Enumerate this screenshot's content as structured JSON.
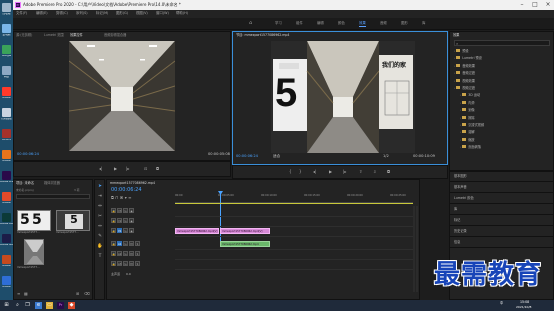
{
  "window": {
    "title": "Adobe Premiere Pro 2020 - C:\\用户\\Video\\文档\\Adobe\\Premiere Pro\\14.0\\未命名 *",
    "app_badge": "Pr"
  },
  "desktop": {
    "icons": [
      {
        "label": "回收站",
        "color": "#9fb7cc"
      },
      {
        "label": "此电脑",
        "color": "#7ab6e8"
      },
      {
        "label": "Google",
        "color": "#3aa35a"
      },
      {
        "label": "网络",
        "color": "#8da9c4"
      },
      {
        "label": "Adobe",
        "color": "#ff3a2a"
      },
      {
        "label": "控制面板",
        "color": "#c9d4e0"
      },
      {
        "label": "ACCES",
        "color": "#a5312b"
      },
      {
        "label": "Adobe",
        "color": "#e6741c"
      },
      {
        "label": "Adobe Premi",
        "color": "#2a0a4a"
      },
      {
        "label": "Adobe",
        "color": "#e34a2a"
      },
      {
        "label": "Adobe Audition",
        "color": "#0b3a38"
      },
      {
        "label": "Adobe Media",
        "color": "#1c1c48"
      },
      {
        "label": "Adobe",
        "color": "#c54a1e"
      },
      {
        "label": "Adobe",
        "color": "#2e6ed6"
      }
    ]
  },
  "menubar": {
    "items": [
      "文件(F)",
      "编辑(E)",
      "剪辑(C)",
      "序列(S)",
      "标记(M)",
      "图形(G)",
      "视图(V)",
      "窗口(W)",
      "帮助(H)"
    ]
  },
  "workspaces": {
    "items": [
      "学习",
      "组件",
      "编辑",
      "颜色",
      "效果",
      "音频",
      "图形",
      "库"
    ],
    "active_index": 4
  },
  "source_monitor": {
    "tabs": [
      "源:(无剪辑)",
      "Lumetri 范围",
      "效果控件",
      "音频剪辑混合器"
    ],
    "clip_tab": "mmexport1577086962.mp4",
    "timecode_in": "00:00:06:24",
    "timecode_out": "00:00:05:08",
    "fit": "适合"
  },
  "program_monitor": {
    "tab": "节目: mmexport1577086962.mp4",
    "timecode_in": "00:00:06:24",
    "timecode_out": "00:00:10:09",
    "fit": "适合",
    "resolution": "1/2",
    "sign_number": "5",
    "sign_text": "我们的家"
  },
  "project": {
    "tabs": [
      "项目: 未命名",
      "媒体浏览器"
    ],
    "file": "未命名.prproj",
    "item_count": "3 项",
    "search_placeholder": "",
    "items": [
      {
        "name": "mmexport1577...",
        "duration": "5:08"
      },
      {
        "name": "mmexport1577...",
        "duration": "5:08"
      },
      {
        "name": "mmexport1577...",
        "duration": "10:09"
      }
    ]
  },
  "timeline": {
    "tab": "mmexport1577086962.mp4",
    "timecode": "00:00:06:24",
    "ruler": [
      "00:00",
      "00:00:05:00",
      "00:00:10:00",
      "00:00:15:00",
      "00:00:20:00",
      "00:00:25:00"
    ],
    "tracks": [
      {
        "name": "V3"
      },
      {
        "name": "V2"
      },
      {
        "name": "V1"
      },
      {
        "name": "A1"
      },
      {
        "name": "A2"
      },
      {
        "name": "A3"
      }
    ],
    "master": "主声道",
    "master_value": "0.0",
    "clips": [
      {
        "label": "mmexport1577086962.mp4[V]",
        "track": "V1"
      },
      {
        "label": "mmexport1577086962.mp4[V]",
        "track": "V1"
      },
      {
        "label": "mmexport1577086962.mp4",
        "track": "A1"
      }
    ]
  },
  "effects": {
    "title": "效果",
    "search_placeholder": "",
    "tree": [
      {
        "label": "预设",
        "indent": 0
      },
      {
        "label": "Lumetri 预设",
        "indent": 0
      },
      {
        "label": "音频效果",
        "indent": 0
      },
      {
        "label": "音频过渡",
        "indent": 0
      },
      {
        "label": "视频效果",
        "indent": 0
      },
      {
        "label": "视频过渡",
        "indent": 0
      },
      {
        "label": "3D 运动",
        "indent": 1
      },
      {
        "label": "内滑",
        "indent": 1
      },
      {
        "label": "划像",
        "indent": 1
      },
      {
        "label": "擦除",
        "indent": 1
      },
      {
        "label": "沉浸式视频",
        "indent": 1
      },
      {
        "label": "溶解",
        "indent": 1
      },
      {
        "label": "缩放",
        "indent": 1
      },
      {
        "label": "页面剥落",
        "indent": 1
      }
    ],
    "sections": [
      "基本图形",
      "基本声音",
      "Lumetri 颜色",
      "库",
      "标记",
      "历史记录",
      "信息"
    ]
  },
  "taskbar": {
    "time": "15:08",
    "date": "2021/10/8",
    "ime": "中"
  },
  "watermark": "最需教育"
}
